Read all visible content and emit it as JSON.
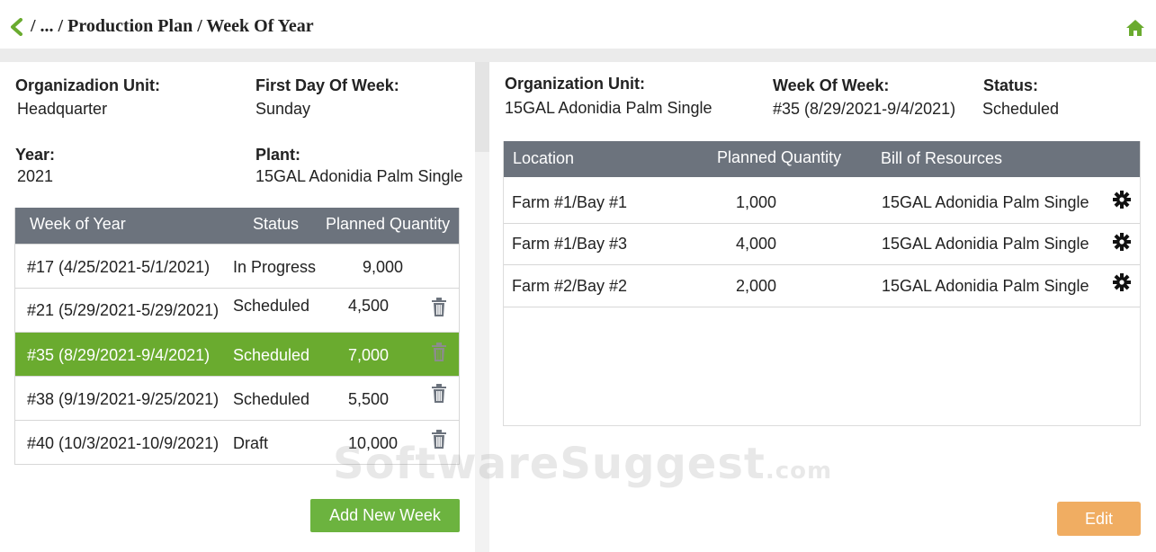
{
  "header": {
    "breadcrumb": "/ ... / Production Plan / Week Of Year",
    "accent_color": "#6aab2f"
  },
  "left": {
    "org_unit_label": "Organizadion Unit:",
    "org_unit_value": "Headquarter",
    "first_day_label": "First Day Of Week:",
    "first_day_value": "Sunday",
    "year_label": "Year:",
    "year_value": "2021",
    "plant_label": "Plant:",
    "plant_value": "15GAL Adonidia Palm Single",
    "table": {
      "columns": [
        "Week of Year",
        "Status",
        "Planned Quantity"
      ],
      "rows": [
        {
          "week": "#17 (4/25/2021-5/1/2021)",
          "status": "In Progress",
          "qty": "9,000",
          "deletable": false,
          "selected": false
        },
        {
          "week": "#21 (5/29/2021-5/29/2021)",
          "status": "Scheduled",
          "qty": "4,500",
          "deletable": true,
          "selected": false
        },
        {
          "week": "#35 (8/29/2021-9/4/2021)",
          "status": "Scheduled",
          "qty": "7,000",
          "deletable": true,
          "selected": true
        },
        {
          "week": "#38 (9/19/2021-9/25/2021)",
          "status": "Scheduled",
          "qty": "5,500",
          "deletable": true,
          "selected": false
        },
        {
          "week": "#40 (10/3/2021-10/9/2021)",
          "status": "Draft",
          "qty": "10,000",
          "deletable": true,
          "selected": false
        }
      ]
    },
    "add_week_label": "Add New Week"
  },
  "right": {
    "org_unit_label": "Organization Unit:",
    "org_unit_value": "15GAL Adonidia Palm Single",
    "week_label": "Week Of Week:",
    "week_value": "#35 (8/29/2021-9/4/2021)",
    "status_label": "Status:",
    "status_value": "Scheduled",
    "table": {
      "columns": [
        "Location",
        "Planned Quantity",
        "Bill of Resources"
      ],
      "rows": [
        {
          "location": "Farm #1/Bay #1",
          "qty": "1,000",
          "bor": "15GAL Adonidia Palm Single"
        },
        {
          "location": "Farm #1/Bay #3",
          "qty": "4,000",
          "bor": "15GAL Adonidia Palm Single"
        },
        {
          "location": "Farm #2/Bay #2",
          "qty": "2,000",
          "bor": "15GAL Adonidia Palm Single"
        }
      ]
    },
    "edit_label": "Edit"
  },
  "watermark": {
    "main": "SoftwareSuggest",
    "suffix": ".com"
  }
}
